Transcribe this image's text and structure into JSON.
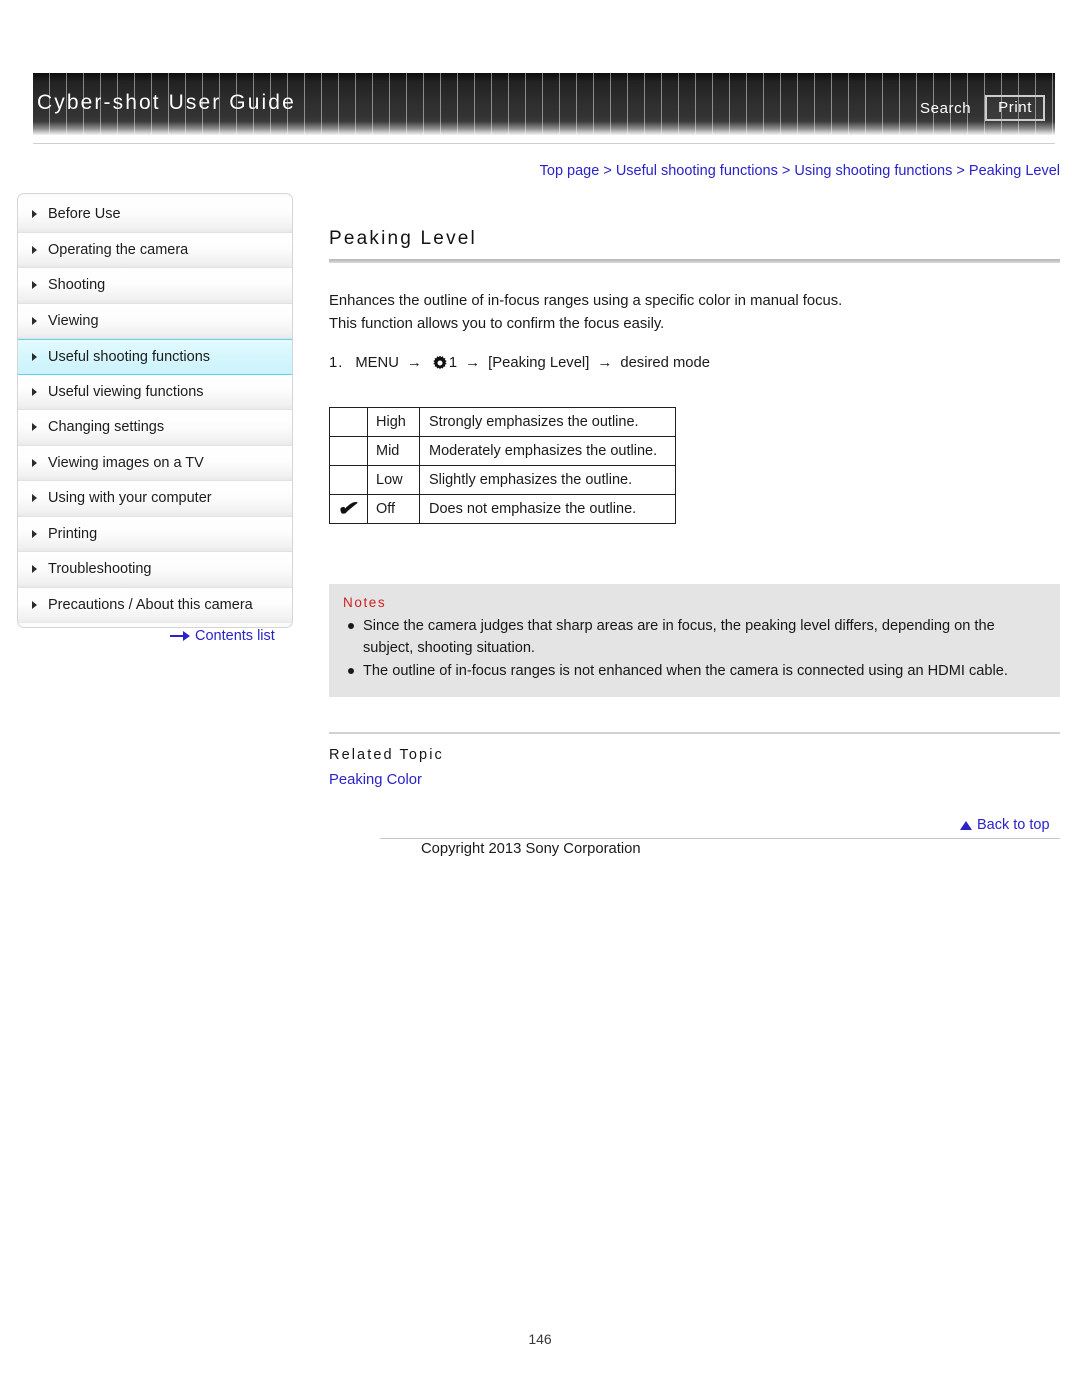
{
  "header": {
    "title": "Cyber-shot User Guide",
    "search_label": "Search",
    "print_label": "Print"
  },
  "breadcrumb": {
    "items": [
      "Top page",
      "Useful shooting functions",
      "Using shooting functions",
      "Peaking Level"
    ],
    "separator": ">"
  },
  "sidebar": {
    "items": [
      {
        "label": "Before Use",
        "active": false
      },
      {
        "label": "Operating the camera",
        "active": false
      },
      {
        "label": "Shooting",
        "active": false
      },
      {
        "label": "Viewing",
        "active": false
      },
      {
        "label": "Useful shooting functions",
        "active": true
      },
      {
        "label": "Useful viewing functions",
        "active": false
      },
      {
        "label": "Changing settings",
        "active": false
      },
      {
        "label": "Viewing images on a TV",
        "active": false
      },
      {
        "label": "Using with your computer",
        "active": false
      },
      {
        "label": "Printing",
        "active": false
      },
      {
        "label": "Troubleshooting",
        "active": false
      },
      {
        "label": "Precautions / About this camera",
        "active": false
      }
    ],
    "contents_list_label": "Contents list"
  },
  "main": {
    "title": "Peaking Level",
    "intro_line1": "Enhances the outline of in-focus ranges using a specific color in manual focus.",
    "intro_line2": "This function allows you to confirm the focus easily.",
    "step": {
      "number": "1.",
      "menu_label": "MENU",
      "arrow": "→",
      "gear_number": "1",
      "item_label": "[Peaking Level]",
      "result_label": "desired mode"
    },
    "table": {
      "rows": [
        {
          "checked": "",
          "label": "High",
          "description": "Strongly emphasizes the outline."
        },
        {
          "checked": "",
          "label": "Mid",
          "description": "Moderately emphasizes the outline."
        },
        {
          "checked": "",
          "label": "Low",
          "description": "Slightly emphasizes the outline."
        },
        {
          "checked": "✔",
          "label": "Off",
          "description": "Does not emphasize the outline."
        }
      ]
    },
    "notes": {
      "title": "Notes",
      "items": [
        "Since the camera judges that sharp areas are in focus, the peaking level differs, depending on the subject, shooting situation.",
        "The outline of in-focus ranges is not enhanced when the camera is connected using an HDMI cable."
      ]
    },
    "related": {
      "title": "Related Topic",
      "link": "Peaking Color"
    }
  },
  "footer": {
    "back_to_top": "Back to top",
    "copyright": "Copyright 2013 Sony Corporation",
    "page_number": "146"
  },
  "colors": {
    "link": "#2a23c8",
    "notes_title": "#cc2222",
    "active_item": "#cdf2fb",
    "active_border": "#5fd3ee",
    "notes_bg": "#e4e4e4"
  }
}
